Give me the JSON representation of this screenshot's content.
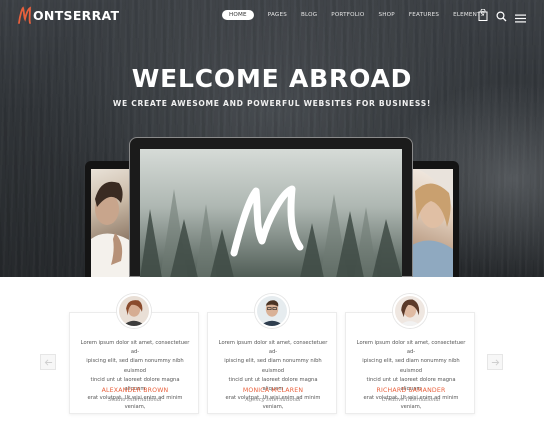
{
  "brand": {
    "logo_letter": "M",
    "logo_rest": "ONTSERRAT",
    "accent_color": "#e8603c"
  },
  "nav": {
    "items": [
      {
        "label": "HOME",
        "active": true
      },
      {
        "label": "PAGES"
      },
      {
        "label": "BLOG"
      },
      {
        "label": "PORTFOLIO"
      },
      {
        "label": "SHOP"
      },
      {
        "label": "FEATURES"
      },
      {
        "label": "ELEMENTS"
      }
    ],
    "cart_count": "0",
    "icons": [
      "shopping-bag-icon",
      "search-icon",
      "menu-icon"
    ]
  },
  "hero": {
    "title": "WELCOME ABROAD",
    "subtitle": "WE CREATE AWESOME AND POWERFUL WEBSITES FOR BUSINESS!"
  },
  "testimonials": [
    {
      "quote_lines": [
        "Lorem ipsum dolor sit amet, consectetuer ad-",
        "ipiscing elit, sed diam nonummy nibh euismod",
        "tincid  unt ut laoreet dolore magna aliquam",
        "erat volutpat. Ut wisi enim ad minim veniam,"
      ],
      "author": "ALEXANDER BROWN",
      "company": "Studio International"
    },
    {
      "quote_lines": [
        "Lorem ipsum dolor sit amet, consectetuer ad-",
        "ipiscing elit, sed diam nonummy nibh euismod",
        "tincid  unt ut laoreet dolore magna aliquam",
        "erat volutpat. Ut wisi enim ad minim veniam,"
      ],
      "author": "MONICA MCLAREN",
      "company": "Agency International"
    },
    {
      "quote_lines": [
        "Lorem ipsum dolor sit amet, consectetuer ad-",
        "ipiscing elit, sed diam nonummy nibh euismod",
        "tincid  unt ut laoreet dolore magna aliquam",
        "erat volutpat. Ut wisi enim ad minim veniam,"
      ],
      "author": "RICHARD SAMANDER",
      "company": "Creative International"
    }
  ],
  "carousel": {
    "prev_icon": "arrow-left-icon",
    "next_icon": "arrow-right-icon"
  }
}
